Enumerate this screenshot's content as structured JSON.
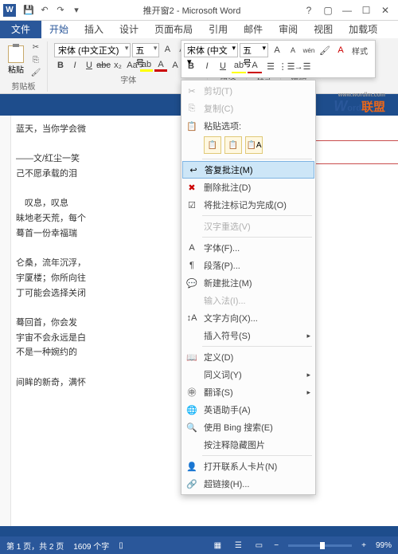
{
  "title": "推开窗2 - Microsoft Word",
  "tabs": {
    "file": "文件",
    "home": "开始",
    "insert": "插入",
    "design": "设计",
    "layout": "页面布局",
    "ref": "引用",
    "mail": "邮件",
    "review": "审阅",
    "view": "视图",
    "addins": "加载项"
  },
  "ribbon": {
    "clipboard": "剪贴板",
    "paste": "粘贴",
    "font": "字体",
    "fontname": "宋体 (中文正文)",
    "fontsize": "五号",
    "para": "段落",
    "styles": "样式",
    "editing": "编辑"
  },
  "watermark": {
    "w": "W",
    "ord": "ord",
    "lm": "联盟",
    "url": "www.wordlm.com"
  },
  "doc": {
    "l1": "蓝天，当你学会微",
    "l2": "——文/红尘一笑",
    "l3": "己不愿承载的泪",
    "l4": "　叹息，叹息",
    "l5": "昧地老天荒，每个",
    "l6": "蓦首一份幸福瑞",
    "l7": "仑桑，流年沉浮，",
    "l8": "宇厦楼；你所向往",
    "l9": "丁可能会选择关闭",
    "l10": "蓦回首，你会发",
    "l11": "宇宙不会永远是白",
    "l12": "不是一种婉约的",
    "l13": "间眸的新奇，满怀"
  },
  "mini": {
    "font": "宋体 (中文▾",
    "size": "五号",
    "styles": "样式"
  },
  "context": {
    "cut": "剪切(T)",
    "copy": "复制(C)",
    "pasteopt": "粘贴选项:",
    "reply": "答复批注(M)",
    "delete": "删除批注(D)",
    "done": "将批注标记为完成(O)",
    "hanzi": "汉字重选(V)",
    "font": "字体(F)...",
    "para": "段落(P)...",
    "comment": "新建批注(M)",
    "ime": "输入法(I)...",
    "dir": "文字方向(X)...",
    "symbol": "插入符号(S)",
    "define": "定义(D)",
    "synonym": "同义词(Y)",
    "translate": "翻译(S)",
    "eng": "英语助手(A)",
    "bing": "使用 Bing 搜索(E)",
    "toggle": "按注释隐藏图片",
    "contact": "打开联系人卡片(N)",
    "link": "超链接(H)..."
  },
  "status": {
    "page": "第 1 页，共 2 页",
    "words": "1609 个字",
    "zoom": "99%"
  }
}
